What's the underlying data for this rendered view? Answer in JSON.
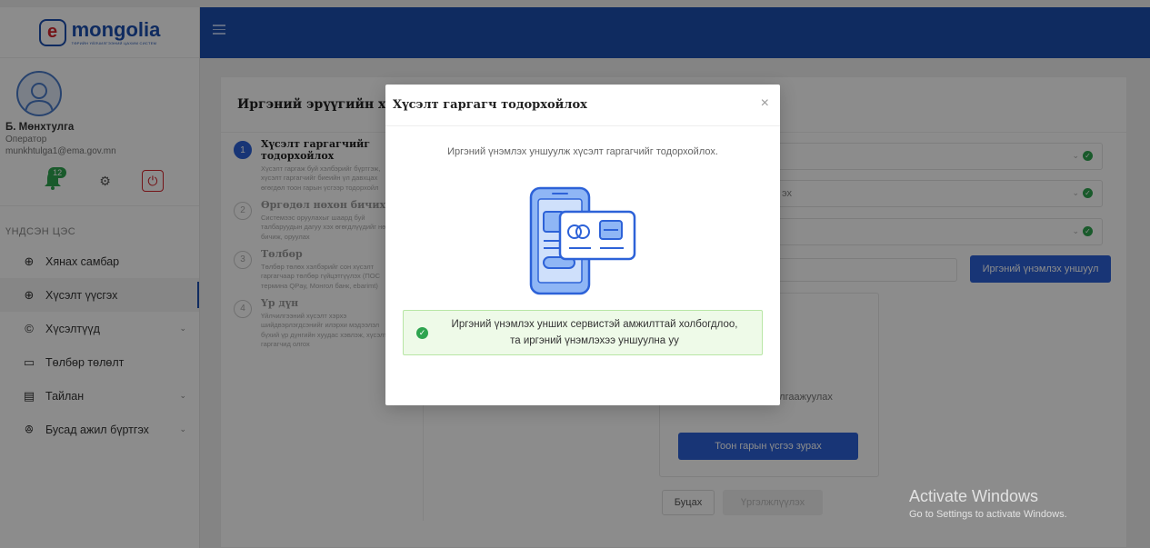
{
  "app": {
    "logo_letter": "e",
    "logo_name": "mongolia",
    "logo_tagline": "ТӨРИЙН ҮЙЛЧИЛГЭЭНИЙ ЦАХИМ СИСТЕМ"
  },
  "user": {
    "name": "Б. Мөнхтулга",
    "role": "Оператор",
    "email": "munkhtulga1@ema.gov.mn",
    "notification_count": "12"
  },
  "sidebar": {
    "heading": "ҮНДСЭН ЦЭС",
    "items": [
      {
        "label": "Хянах самбар",
        "icon": "plus-circle-icon",
        "active": false,
        "expandable": false
      },
      {
        "label": "Хүсэлт үүсгэх",
        "icon": "plus-circle-icon",
        "active": true,
        "expandable": false
      },
      {
        "label": "Хүсэлтүүд",
        "icon": "request-icon",
        "active": false,
        "expandable": true
      },
      {
        "label": "Төлбөр төлөлт",
        "icon": "wallet-icon",
        "active": false,
        "expandable": false
      },
      {
        "label": "Тайлан",
        "icon": "report-icon",
        "active": false,
        "expandable": true
      },
      {
        "label": "Бусад ажил бүртгэх",
        "icon": "users-icon",
        "active": false,
        "expandable": true
      }
    ]
  },
  "main": {
    "title": "Иргэний эрүүгийн ха",
    "steps": [
      {
        "num": "1",
        "title": "Хүсэлт гаргагчийг тодорхойлох",
        "desc": "Хүсэлт гаргаж буй хэлбэрийг бүртгэж, хүсэлт гаргагчийг биеийн үл давхцах өгөгдөл тоон гарын үсгээр тодорхойл",
        "active": true
      },
      {
        "num": "2",
        "title": "Өргөдөл нөхөн бичих",
        "desc": "Системээс оруулахыг шаард буй талбаруудын дагуу хэх өгөгдлүүдийг нөхөн бичиж, оруулах",
        "active": false
      },
      {
        "num": "3",
        "title": "Төлбөр",
        "desc": "Төлбөр төлөх хэлбэрийг сон хүсэлт гаргагчаар төлбөр гүйцэтгүүлэх (ПОС термина QPay, Монгол банк, ebarimt)",
        "active": false
      },
      {
        "num": "4",
        "title": "Үр дүн",
        "desc": "Үйлчилгээний хүсэлт хэрхэ шийдвэрлэгдсэнийг илэрхи мэдээлэл бүхий үр дүнгийн хуудас хэвлэж, хүсэлт гаргагчид олгох",
        "active": false
      }
    ],
    "fields": [
      "",
      "эх",
      ""
    ],
    "id_button": "Иргэний үнэмлэх уншуул",
    "signature_text": "арын үсгээ зуран баталгаажуулах",
    "signature_button": "Тоон гарын үсгээ зурах",
    "back_button": "Буцах",
    "next_button": "Үргэлжлүүлэх"
  },
  "modal": {
    "title": "Хүсэлт гаргагч тодорхойлох",
    "close": "×",
    "subtitle": "Иргэний үнэмлэх уншуулж хүсэлт гаргагчийг тодорхойлох.",
    "alert_line1": "Иргэний үнэмлэх унших сервистэй амжилттай холбогдлоо,",
    "alert_line2": "та иргэний үнэмлэхээ уншуулна уу"
  },
  "watermark": {
    "line1": "Activate Windows",
    "line2": "Go to Settings to activate Windows."
  },
  "colors": {
    "brand": "#1c4fb0",
    "primary_button": "#2d62d8",
    "success": "#2ea44f",
    "logout": "#d4262c"
  }
}
